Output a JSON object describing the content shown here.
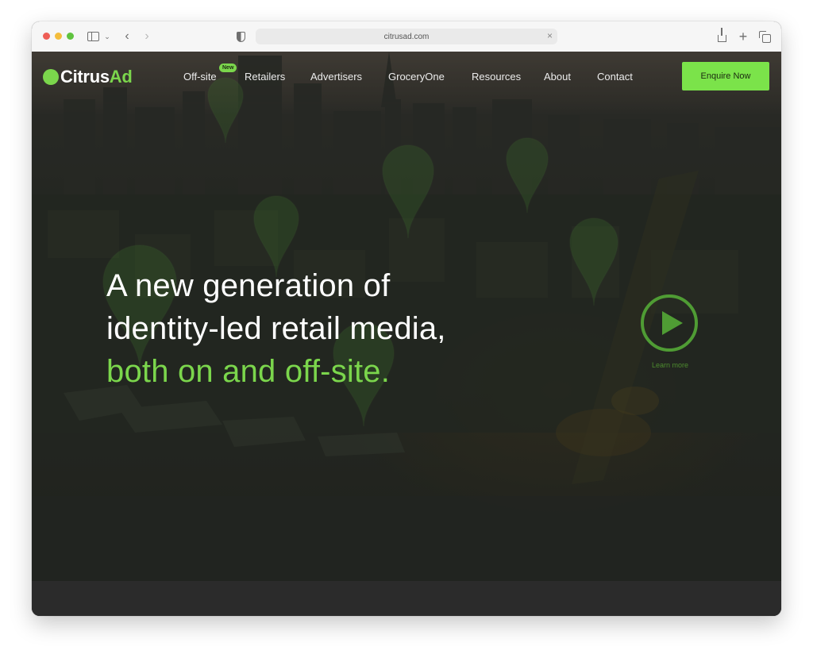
{
  "browser": {
    "url": "citrusad.com",
    "address_close": "×",
    "back": "‹",
    "forward": "›",
    "new_tab": "+",
    "sidebar_chevron": "⌄"
  },
  "logo": {
    "text_main": "Citrus",
    "text_accent": "Ad"
  },
  "nav": {
    "items": [
      "Off-site",
      "Retailers",
      "Advertisers",
      "GroceryOne",
      "Resources",
      "About",
      "Contact"
    ],
    "new_badge": "New",
    "cta": "Enquire Now"
  },
  "hero": {
    "line1": "A new generation of",
    "line2": "identity-led retail media,",
    "line3": "both on and off-site."
  },
  "video": {
    "learn_more": "Learn more"
  },
  "colors": {
    "accent": "#7bd64c",
    "cta": "#7be34a",
    "pin": "#4f9c34"
  },
  "icons": [
    "sidebar-icon",
    "back-icon",
    "forward-icon",
    "shield-icon",
    "share-icon",
    "plus-icon",
    "tabs-icon",
    "play-icon",
    "location-pin-icon"
  ]
}
